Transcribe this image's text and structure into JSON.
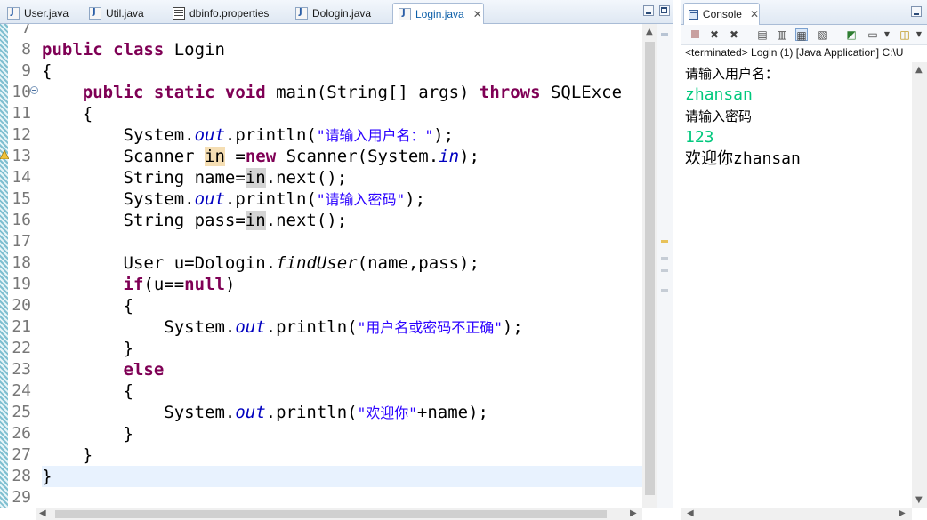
{
  "editor": {
    "tabs": [
      {
        "label": "User.java",
        "icon": "java-file-icon",
        "active": false
      },
      {
        "label": "Util.java",
        "icon": "java-file-icon",
        "active": false
      },
      {
        "label": "dbinfo.properties",
        "icon": "properties-file-icon",
        "active": false
      },
      {
        "label": "Dologin.java",
        "icon": "java-file-icon",
        "active": false
      },
      {
        "label": "Login.java",
        "icon": "java-file-icon",
        "active": true
      }
    ],
    "close_glyph": "✕",
    "line_numbers": [
      "7",
      "8",
      "9",
      "10",
      "11",
      "12",
      "13",
      "14",
      "15",
      "16",
      "17",
      "18",
      "19",
      "20",
      "21",
      "22",
      "23",
      "24",
      "25",
      "26",
      "27",
      "28",
      "29"
    ],
    "code_lines": [
      [],
      [
        {
          "t": "public class ",
          "c": "kw"
        },
        {
          "t": "Login"
        }
      ],
      [
        {
          "t": "{"
        }
      ],
      [
        {
          "t": "    "
        },
        {
          "t": "public static void ",
          "c": "kw"
        },
        {
          "t": "main(String[] args) "
        },
        {
          "t": "throws ",
          "c": "kw"
        },
        {
          "t": "SQLExce"
        }
      ],
      [
        {
          "t": "    {"
        }
      ],
      [
        {
          "t": "        System."
        },
        {
          "t": "out",
          "c": "fld"
        },
        {
          "t": ".println("
        },
        {
          "t": "\"请输入用户名：\"",
          "c": "st"
        },
        {
          "t": ");"
        }
      ],
      [
        {
          "t": "        Scanner "
        },
        {
          "t": "in",
          "c": "hlw"
        },
        {
          "t": " ="
        },
        {
          "t": "new ",
          "c": "kw"
        },
        {
          "t": "Scanner(System."
        },
        {
          "t": "in",
          "c": "fld"
        },
        {
          "t": ");"
        }
      ],
      [
        {
          "t": "        String name="
        },
        {
          "t": "in",
          "c": "hl"
        },
        {
          "t": ".next();"
        }
      ],
      [
        {
          "t": "        System."
        },
        {
          "t": "out",
          "c": "fld"
        },
        {
          "t": ".println("
        },
        {
          "t": "\"请输入密码\"",
          "c": "st"
        },
        {
          "t": ");"
        }
      ],
      [
        {
          "t": "        String pass="
        },
        {
          "t": "in",
          "c": "hl"
        },
        {
          "t": ".next();"
        }
      ],
      [],
      [
        {
          "t": "        User u=Dologin."
        },
        {
          "t": "findUser",
          "c": "it"
        },
        {
          "t": "(name,pass);"
        }
      ],
      [
        {
          "t": "        "
        },
        {
          "t": "if",
          "c": "kw"
        },
        {
          "t": "(u=="
        },
        {
          "t": "null",
          "c": "kw"
        },
        {
          "t": ")"
        }
      ],
      [
        {
          "t": "        {"
        }
      ],
      [
        {
          "t": "            System."
        },
        {
          "t": "out",
          "c": "fld"
        },
        {
          "t": ".println("
        },
        {
          "t": "\"用户名或密码不正确\"",
          "c": "st"
        },
        {
          "t": ");"
        }
      ],
      [
        {
          "t": "        }"
        }
      ],
      [
        {
          "t": "        "
        },
        {
          "t": "else",
          "c": "kw"
        }
      ],
      [
        {
          "t": "        {"
        }
      ],
      [
        {
          "t": "            System."
        },
        {
          "t": "out",
          "c": "fld"
        },
        {
          "t": ".println("
        },
        {
          "t": "\"欢迎你\"",
          "c": "st"
        },
        {
          "t": "+name);"
        }
      ],
      [
        {
          "t": "        }"
        }
      ],
      [
        {
          "t": "    }"
        }
      ],
      [
        {
          "t": "}"
        }
      ],
      []
    ],
    "current_line_index": 21,
    "colors": {
      "keyword": "#7f0055",
      "field": "#0000c0",
      "string": "#2a00ff",
      "line_number": "#787878",
      "current_line": "#e8f2fe"
    }
  },
  "console": {
    "tab_label": "Console",
    "close_glyph": "✕",
    "status": "<terminated> Login (1) [Java Application] C:\\U",
    "toolbar_icons": [
      "terminate-icon",
      "remove-launch-icon",
      "remove-all-icon",
      "clear-console-icon",
      "scroll-lock-icon",
      "word-wrap-icon",
      "show-on-output-icon",
      "pin-console-icon",
      "display-console-icon",
      "open-console-icon"
    ],
    "output": [
      {
        "text": "请输入用户名：",
        "kind": "plain"
      },
      {
        "text": "zhansan",
        "kind": "inp"
      },
      {
        "text": "请输入密码",
        "kind": "plain"
      },
      {
        "text": "123",
        "kind": "inp"
      },
      {
        "text": "欢迎你zhansan",
        "kind": "mix"
      }
    ],
    "colors": {
      "user_input": "#00c87d"
    }
  }
}
